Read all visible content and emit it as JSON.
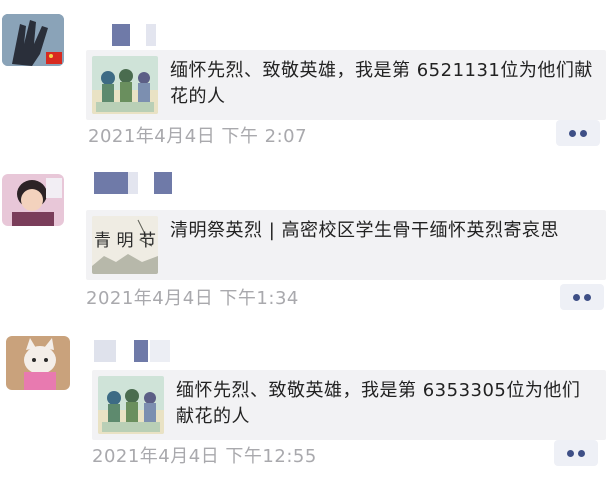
{
  "posts": [
    {
      "title": "缅怀先烈、致敬英雄，我是第 6521131位为他们献花的人",
      "time": "2021年4月4日 下午 2:07"
    },
    {
      "title": "清明祭英烈 | 高密校区学生骨干缅怀英烈寄哀思",
      "time": "2021年4月4日 下午1:34",
      "thumb_text": [
        "青",
        "明",
        "节"
      ]
    },
    {
      "title": "缅怀先烈、致敬英雄，我是第 6353305位为他们献花的人",
      "time": "2021年4月4日 下午12:55"
    }
  ],
  "colors": {
    "background": "#ffffff",
    "card": "#f2f2f4",
    "meta_text": "#a9a9ad",
    "more_dots": "#3e4f86"
  }
}
